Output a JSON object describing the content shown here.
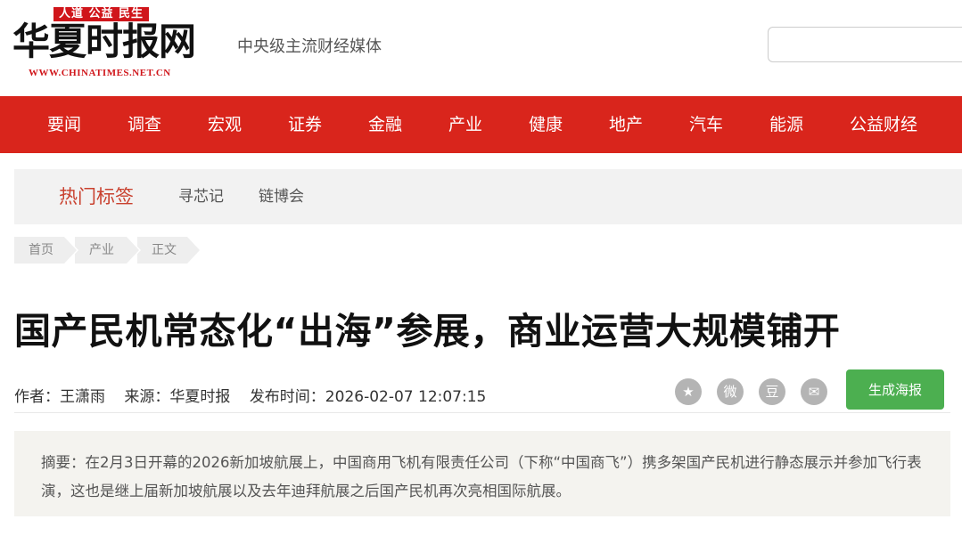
{
  "header": {
    "logo_tagline": "人道 公益 民生",
    "logo_main": "华夏时报网",
    "logo_sub": "WWW.CHINATIMES.NET.CN",
    "slogan": "中央级主流财经媒体",
    "search": {
      "value": "",
      "placeholder": ""
    }
  },
  "nav": {
    "items": [
      "要闻",
      "调查",
      "宏观",
      "证券",
      "金融",
      "产业",
      "健康",
      "地产",
      "汽车",
      "能源",
      "公益财经"
    ]
  },
  "hot_tags": {
    "title": "热门标签",
    "tags": [
      "寻芯记",
      "链博会"
    ]
  },
  "breadcrumb": [
    "首页",
    "产业",
    "正文"
  ],
  "article": {
    "title": "国产民机常态化“出海”参展，商业运营大规模铺开",
    "author": "作者：王潇雨",
    "source": "来源：华夏时报",
    "published": "发布时间：2026-02-07 12:07:15",
    "summary": "摘要：在2月3日开幕的2026新加坡航展上，中国商用飞机有限责任公司（下称“中国商飞”）携多架国产民机进行静态展示并参加飞行表演，这也是继上届新加坡航展以及去年迪拜航展之后国产民机再次亮相国际航展。"
  },
  "share": {
    "icons": [
      "qzone-star-icon",
      "weibo-icon",
      "douban-icon",
      "wechat-icon"
    ],
    "glyphs": [
      "★",
      "微",
      "豆",
      "✉"
    ]
  },
  "poster_button": "生成海报",
  "colors": {
    "nav_bg": "#d9251c",
    "brand_red": "#d0161b",
    "hot_title": "#c9412f",
    "poster_btn": "#4caf50"
  }
}
